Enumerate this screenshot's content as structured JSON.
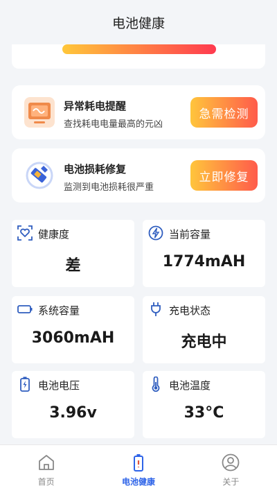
{
  "header": {
    "title": "电池健康"
  },
  "actions": [
    {
      "title": "异常耗电提醒",
      "desc": "查找耗电电量最高的元凶",
      "button": "急需检测",
      "icon": "monitor-icon"
    },
    {
      "title": "电池损耗修复",
      "desc": "监测到电池损耗很严重",
      "button": "立即修复",
      "icon": "wrench-battery-icon"
    }
  ],
  "stats": [
    {
      "label": "健康度",
      "value": "差",
      "icon": "heart-icon"
    },
    {
      "label": "当前容量",
      "value": "1774mAH",
      "icon": "lightning-icon"
    },
    {
      "label": "系统容量",
      "value": "3060mAH",
      "icon": "battery-icon"
    },
    {
      "label": "充电状态",
      "value": "充电中",
      "icon": "plug-icon"
    },
    {
      "label": "电池电压",
      "value": "3.96v",
      "icon": "battery-charge-icon"
    },
    {
      "label": "电池温度",
      "value": "33°C",
      "icon": "thermometer-icon"
    }
  ],
  "tabs": [
    {
      "label": "首页",
      "icon": "home-icon",
      "active": false
    },
    {
      "label": "电池健康",
      "icon": "battery-icon",
      "active": true
    },
    {
      "label": "关于",
      "icon": "user-icon",
      "active": false
    }
  ],
  "colors": {
    "accent": "#2d63e8",
    "button_start": "#ffc53c",
    "button_end": "#ff5b4b",
    "icon_blue": "#2f5dbf"
  }
}
